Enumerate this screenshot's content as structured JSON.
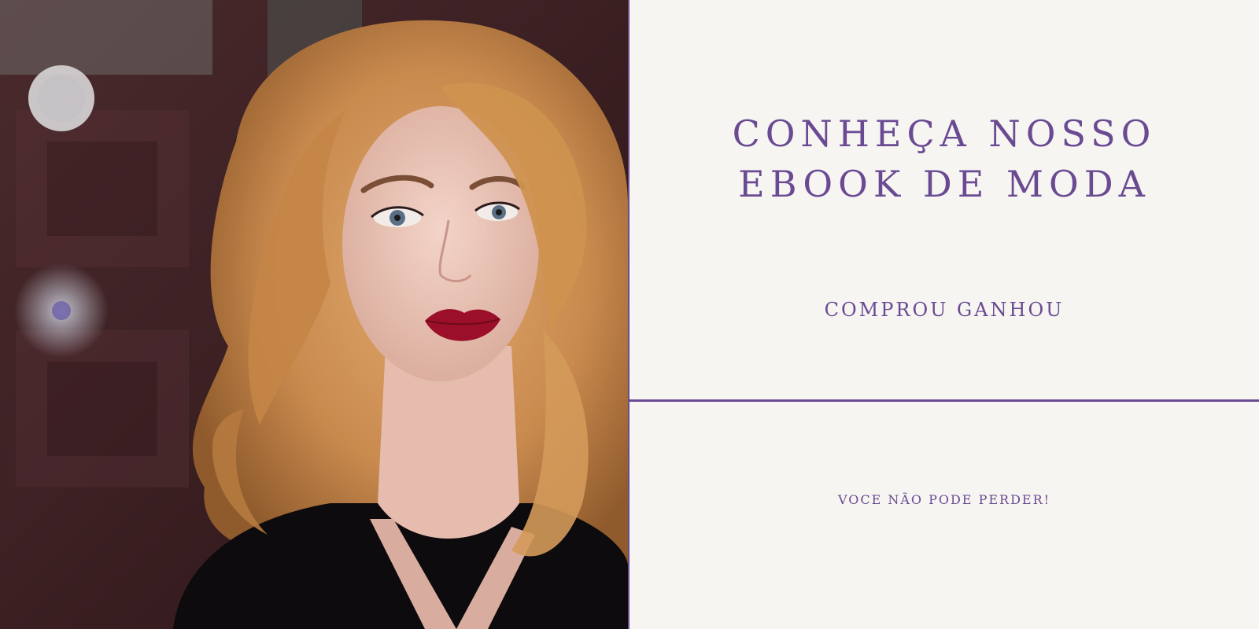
{
  "banner": {
    "headline_line1": "CONHEÇA NOSSO",
    "headline_line2": "EBOOK DE MODA",
    "subheadline": "COMPROU GANHOU",
    "footer_note": "VOCE NÃO PODE PERDER!"
  },
  "photo": {
    "subject": "model-portrait"
  },
  "colors": {
    "accent": "#6a4a92",
    "panel_background": "#f6f5f2"
  }
}
